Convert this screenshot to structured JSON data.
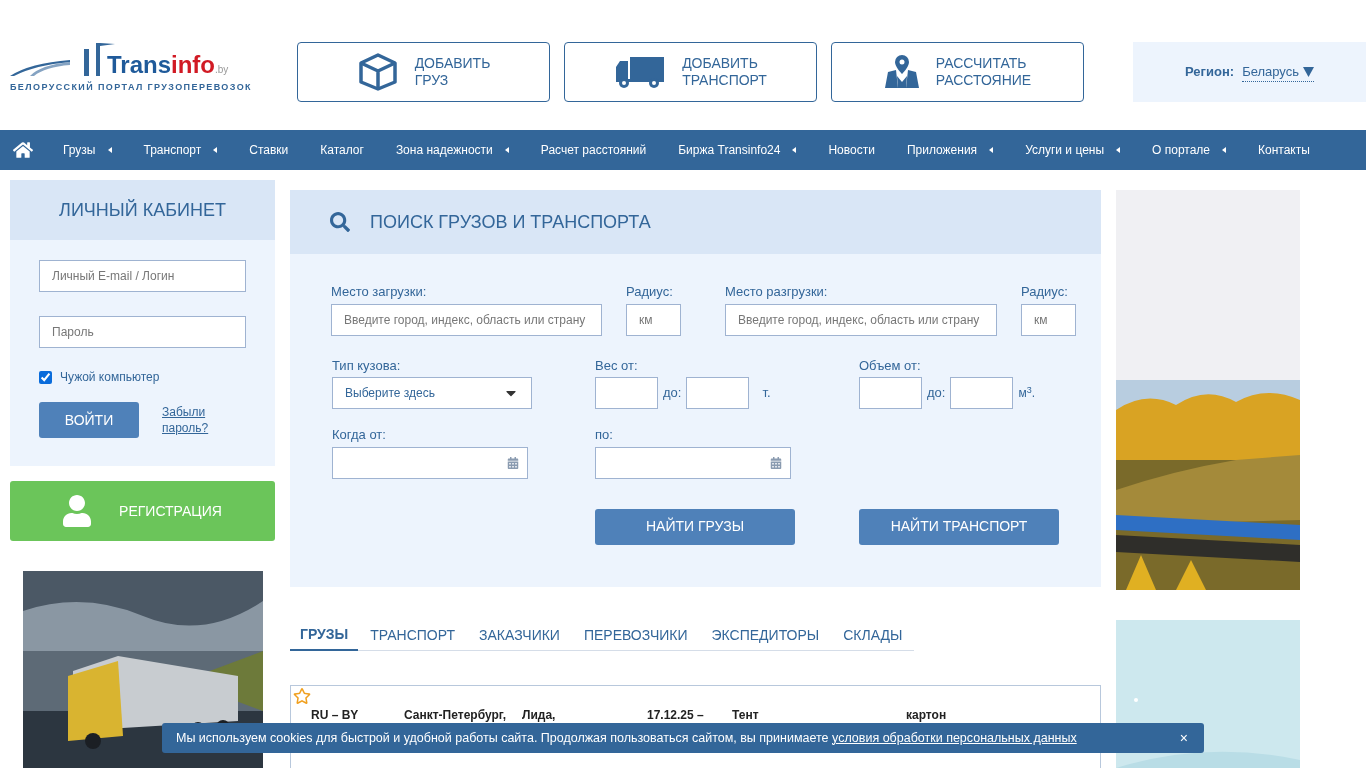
{
  "logo": {
    "name_main": "Trans",
    "name_accent": "info",
    "domain": ".by",
    "tagline": "БЕЛОРУССКИЙ ПОРТАЛ ГРУЗОПЕРЕВОЗОК"
  },
  "header_buttons": [
    {
      "kind": "box",
      "line1": "ДОБАВИТЬ",
      "line2": "ГРУЗ"
    },
    {
      "kind": "truck",
      "line1": "ДОБАВИТЬ",
      "line2": "ТРАНСПОРТ"
    },
    {
      "kind": "map",
      "line1": "РАССЧИТАТЬ",
      "line2": "РАССТОЯНИЕ"
    }
  ],
  "region": {
    "label": "Регион:",
    "value": "Беларусь"
  },
  "nav": [
    {
      "label": "Грузы",
      "submenu": true
    },
    {
      "label": "Транспорт",
      "submenu": true
    },
    {
      "label": "Ставки",
      "submenu": false
    },
    {
      "label": "Каталог",
      "submenu": false
    },
    {
      "label": "Зона надежности",
      "submenu": true
    },
    {
      "label": "Расчет расстояний",
      "submenu": false
    },
    {
      "label": "Биржа Transinfo24",
      "submenu": true
    },
    {
      "label": "Новости",
      "submenu": false
    },
    {
      "label": "Приложения",
      "submenu": true
    },
    {
      "label": "Услуги и цены",
      "submenu": true
    },
    {
      "label": "О портале",
      "submenu": true
    },
    {
      "label": "Контакты",
      "submenu": false
    }
  ],
  "login": {
    "title": "ЛИЧНЫЙ КАБИНЕТ",
    "login_placeholder": "Личный E-mail / Логин",
    "password_placeholder": "Пароль",
    "remember": {
      "label": "Чужой компьютер",
      "checked": true
    },
    "submit": "ВОЙТИ",
    "forgot_line1": "Забыли",
    "forgot_line2": "пароль?"
  },
  "register": "РЕГИСТРАЦИЯ",
  "search": {
    "title": "ПОИСК ГРУЗОВ И ТРАНСПОРТА",
    "from_label": "Место загрузки:",
    "from_placeholder": "Введите город, индекс, область или страну",
    "radius_label": "Радиус:",
    "radius_placeholder": "км",
    "to_label": "Место разгрузки:",
    "to_placeholder": "Введите город, индекс, область или страну",
    "radius2_label": "Радиус:",
    "radius2_placeholder": "км",
    "body_label": "Тип кузова:",
    "body_value": "Выберите здесь",
    "weight_label": "Вес от:",
    "weight_to": "до:",
    "weight_unit": "т.",
    "volume_label": "Объем от:",
    "volume_to": "до:",
    "volume_unit": "м$^{3}$.",
    "date_from_label": "Когда от:",
    "date_to_label": "по:",
    "find_cargo": "НАЙТИ ГРУЗЫ",
    "find_transport": "НАЙТИ ТРАНСПОРТ"
  },
  "tabs": [
    {
      "label": "ГРУЗЫ",
      "selected": true
    },
    {
      "label": "ТРАНСПОРТ",
      "selected": false
    },
    {
      "label": "ЗАКАЗЧИКИ",
      "selected": false
    },
    {
      "label": "ПЕРЕВОЗЧИКИ",
      "selected": false
    },
    {
      "label": "ЭКСПЕДИТОРЫ",
      "selected": false
    },
    {
      "label": "СКЛАДЫ",
      "selected": false
    }
  ],
  "results": [
    {
      "favorite": false,
      "route": "RU – BY",
      "from": "Санкт-Петербург,",
      "to": "Лида,",
      "date": "17.12.25 –",
      "body": "Тент",
      "cargo": "картон"
    }
  ],
  "cookie": {
    "text": "Мы используем cookies для быстрой и удобной работы сайта. Продолжая пользоваться сайтом, вы принимаете",
    "link": "условия обработки персональных данных",
    "close": "×"
  }
}
